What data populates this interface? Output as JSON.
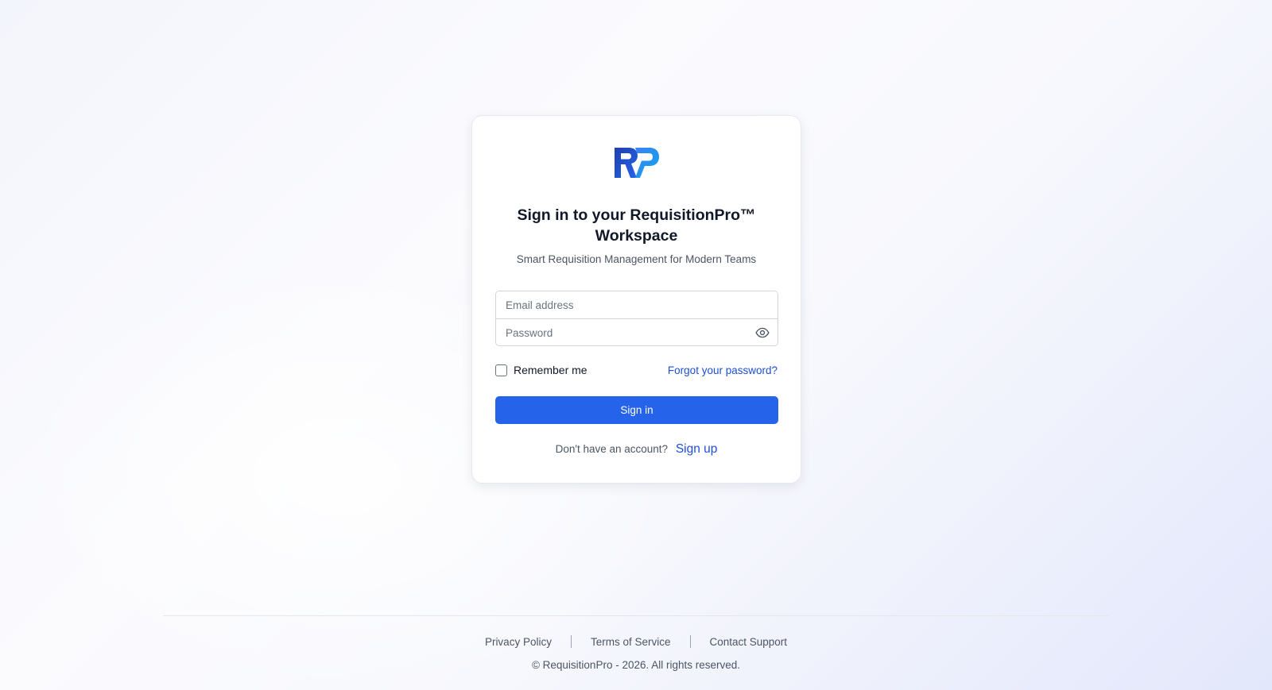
{
  "app": {
    "logo_text": "RP",
    "brand_colors": {
      "primary": "#2563eb",
      "primary_dark": "#1e40af",
      "link": "#1d4ed8"
    }
  },
  "login": {
    "title": "Sign in to your RequisitionPro™ Workspace",
    "subtitle": "Smart Requisition Management for Modern Teams",
    "email": {
      "placeholder": "Email address",
      "value": ""
    },
    "password": {
      "placeholder": "Password",
      "value": "",
      "toggle_icon": "eye-icon"
    },
    "remember_me": {
      "label": "Remember me",
      "checked": false
    },
    "forgot_password_label": "Forgot your password?",
    "signin_label": "Sign in",
    "no_account_text": "Don't have an account?",
    "signup_label": "Sign up"
  },
  "footer": {
    "links": [
      {
        "label": "Privacy Policy"
      },
      {
        "label": "Terms of Service"
      },
      {
        "label": "Contact Support"
      }
    ],
    "copyright": "© RequisitionPro - 2026. All rights reserved."
  }
}
